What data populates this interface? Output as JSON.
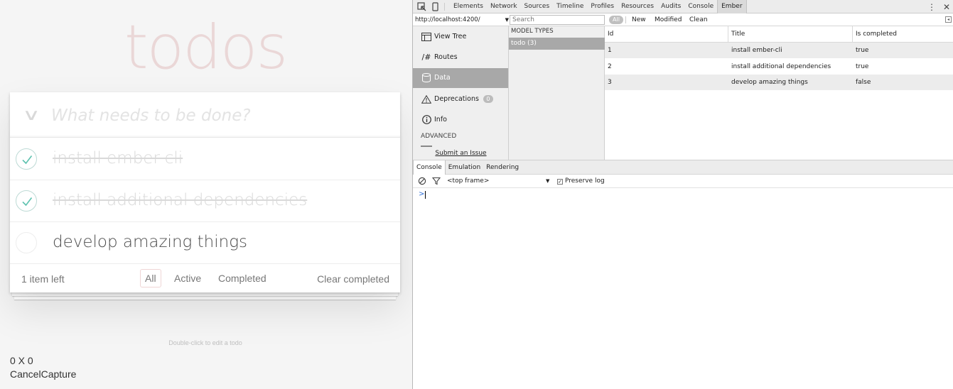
{
  "todo_app": {
    "title": "todos",
    "new_todo_placeholder": "What needs to be done?",
    "todos": [
      {
        "label": "install ember-cli",
        "completed": true
      },
      {
        "label": "install additional dependencies",
        "completed": true
      },
      {
        "label": "develop amazing things",
        "completed": false
      }
    ],
    "footer": {
      "count_text": "1 item left",
      "filters": [
        "All",
        "Active",
        "Completed"
      ],
      "selected_filter": "All",
      "clear_completed": "Clear completed"
    },
    "info_text": "Double-click to edit a todo"
  },
  "overlay": {
    "coords_text": "0 X 0",
    "actions_text": "CancelCapture"
  },
  "devtools": {
    "tabs": [
      "Elements",
      "Network",
      "Sources",
      "Timeline",
      "Profiles",
      "Resources",
      "Audits",
      "Console",
      "Ember"
    ],
    "active_tab": "Ember",
    "toolbar": {
      "url": "http://localhost:4200/",
      "search_placeholder": "Search",
      "all_label": "All",
      "new_label": "New",
      "modified_label": "Modified",
      "clean_label": "Clean"
    },
    "nav": {
      "items": [
        {
          "label": "View Tree",
          "icon": "tree-icon"
        },
        {
          "label": "Routes",
          "icon": "routes-icon"
        },
        {
          "label": "Data",
          "icon": "data-icon"
        },
        {
          "label": "Deprecations",
          "icon": "warning-icon",
          "badge": "0"
        },
        {
          "label": "Info",
          "icon": "info-icon"
        }
      ],
      "active": "Data",
      "section_label": "ADVANCED",
      "submit_issue": "Submit an Issue"
    },
    "model_types": {
      "header": "MODEL TYPES",
      "items": [
        "todo (3)"
      ],
      "selected": "todo (3)"
    },
    "records": {
      "columns": [
        "Id",
        "Title",
        "Is completed"
      ],
      "rows": [
        [
          "1",
          "install ember-cli",
          "true"
        ],
        [
          "2",
          "install additional dependencies",
          "true"
        ],
        [
          "3",
          "develop amazing things",
          "false"
        ]
      ]
    },
    "drawer": {
      "tabs": [
        "Console",
        "Emulation",
        "Rendering"
      ],
      "active_tab": "Console",
      "frame": "<top frame>",
      "preserve_log": "Preserve log",
      "preserve_log_checked": true,
      "prompt": ">"
    }
  },
  "colors": {
    "todo_title": "#efd5d5",
    "check_green": "#5dc2af",
    "ember_active": "#a8a8a8",
    "console_prompt": "#2b6cd8"
  }
}
